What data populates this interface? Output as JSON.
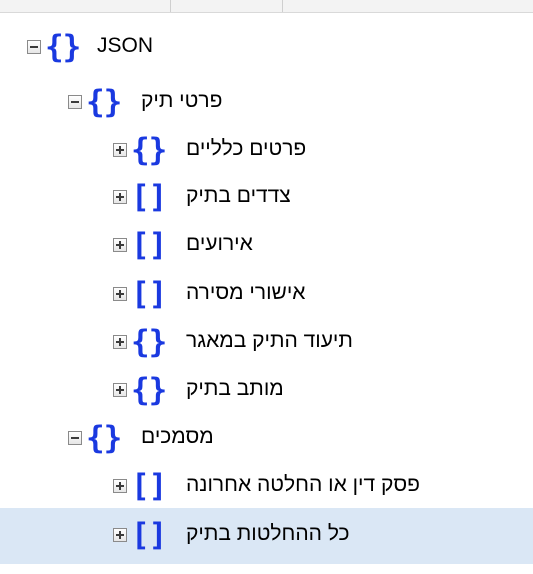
{
  "tree": {
    "nodes": [
      {
        "label": "JSON",
        "type": "object",
        "bracket": "{}",
        "expanded": true,
        "selected": false
      },
      {
        "label": "פרטי תיק",
        "type": "object",
        "bracket": "{}",
        "expanded": true,
        "selected": false
      },
      {
        "label": "פרטים כלליים",
        "type": "object",
        "bracket": "{}",
        "expanded": false,
        "selected": false
      },
      {
        "label": "צדדים בתיק",
        "type": "array",
        "bracket": "[]",
        "expanded": false,
        "selected": false
      },
      {
        "label": "אירועים",
        "type": "array",
        "bracket": "[]",
        "expanded": false,
        "selected": false
      },
      {
        "label": "אישורי מסירה",
        "type": "array",
        "bracket": "[]",
        "expanded": false,
        "selected": false
      },
      {
        "label": "תיעוד התיק במאגר",
        "type": "object",
        "bracket": "{}",
        "expanded": false,
        "selected": false
      },
      {
        "label": "מותב בתיק",
        "type": "object",
        "bracket": "{}",
        "expanded": false,
        "selected": false
      },
      {
        "label": "מסמכים",
        "type": "object",
        "bracket": "{}",
        "expanded": true,
        "selected": false
      },
      {
        "label": "פסק דין או החלטה אחרונה",
        "type": "array",
        "bracket": "[]",
        "expanded": false,
        "selected": false
      },
      {
        "label": "כל ההחלטות בתיק",
        "type": "array",
        "bracket": "[]",
        "expanded": false,
        "selected": true
      }
    ]
  },
  "colors": {
    "bracket": "#1a39e0",
    "selected_row": "#dae7f5",
    "text": "#000000"
  },
  "icons": {
    "expanded": "collapse-minus-icon",
    "collapsed": "expand-plus-icon",
    "object": "curly-braces-icon",
    "array": "square-brackets-icon"
  }
}
